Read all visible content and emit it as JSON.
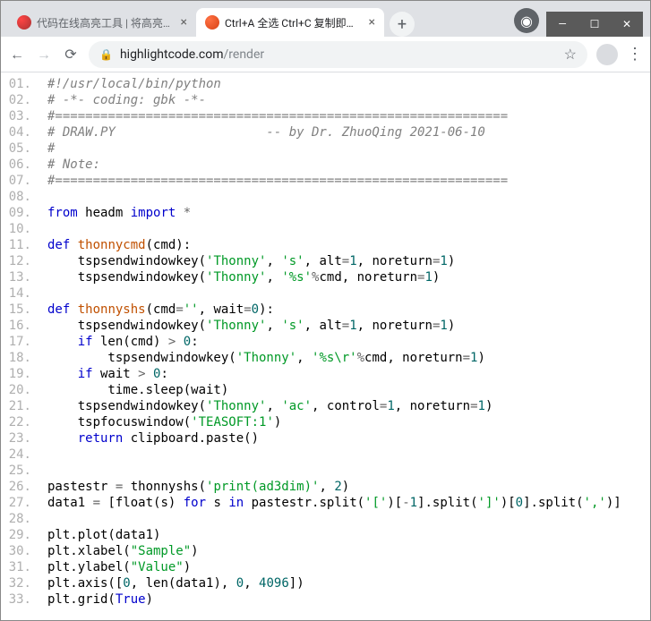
{
  "window": {
    "controls": {
      "min": "—",
      "max": "☐",
      "close": "✕"
    }
  },
  "tabs": {
    "items": [
      {
        "title": "代码在线高亮工具 | 将高亮美化的",
        "active": false
      },
      {
        "title": "Ctrl+A 全选 Ctrl+C 复制即可 - G",
        "active": true
      }
    ],
    "new_tab": "+",
    "account_icon": "◉"
  },
  "toolbar": {
    "back": "←",
    "forward": "→",
    "reload": "⟳",
    "lock": "🔒",
    "url_host": "highlightcode.com",
    "url_path": "/render",
    "star": "☆",
    "menu": "⋮"
  },
  "code": {
    "lines": [
      {
        "n": "01.",
        "segs": [
          [
            "c-comment",
            "#!/usr/local/bin/python"
          ]
        ]
      },
      {
        "n": "02.",
        "segs": [
          [
            "c-comment",
            "# -*- coding: gbk -*-"
          ]
        ]
      },
      {
        "n": "03.",
        "segs": [
          [
            "c-comment",
            "#============================================================"
          ]
        ]
      },
      {
        "n": "04.",
        "segs": [
          [
            "c-comment",
            "# DRAW.PY                    -- by Dr. ZhuoQing 2021-06-10"
          ]
        ]
      },
      {
        "n": "05.",
        "segs": [
          [
            "c-comment",
            "#"
          ]
        ]
      },
      {
        "n": "06.",
        "segs": [
          [
            "c-comment",
            "# Note:"
          ]
        ]
      },
      {
        "n": "07.",
        "segs": [
          [
            "c-comment",
            "#============================================================"
          ]
        ]
      },
      {
        "n": "08.",
        "segs": [
          [
            "c-plain",
            ""
          ]
        ]
      },
      {
        "n": "09.",
        "segs": [
          [
            "c-kw",
            "from"
          ],
          [
            "c-plain",
            " headm "
          ],
          [
            "c-kw",
            "import"
          ],
          [
            "c-plain",
            " "
          ],
          [
            "c-op",
            "*"
          ]
        ]
      },
      {
        "n": "10.",
        "segs": [
          [
            "c-plain",
            ""
          ]
        ]
      },
      {
        "n": "11.",
        "segs": [
          [
            "c-kw",
            "def"
          ],
          [
            "c-plain",
            " "
          ],
          [
            "c-def",
            "thonnycmd"
          ],
          [
            "c-plain",
            "(cmd):"
          ]
        ]
      },
      {
        "n": "12.",
        "segs": [
          [
            "c-plain",
            "    tspsendwindowkey("
          ],
          [
            "c-str",
            "'Thonny'"
          ],
          [
            "c-plain",
            ", "
          ],
          [
            "c-str",
            "'s'"
          ],
          [
            "c-plain",
            ", alt"
          ],
          [
            "c-op",
            "="
          ],
          [
            "c-num",
            "1"
          ],
          [
            "c-plain",
            ", noreturn"
          ],
          [
            "c-op",
            "="
          ],
          [
            "c-num",
            "1"
          ],
          [
            "c-plain",
            ")"
          ]
        ]
      },
      {
        "n": "13.",
        "segs": [
          [
            "c-plain",
            "    tspsendwindowkey("
          ],
          [
            "c-str",
            "'Thonny'"
          ],
          [
            "c-plain",
            ", "
          ],
          [
            "c-str",
            "'%s'"
          ],
          [
            "c-op",
            "%"
          ],
          [
            "c-plain",
            "cmd, noreturn"
          ],
          [
            "c-op",
            "="
          ],
          [
            "c-num",
            "1"
          ],
          [
            "c-plain",
            ")"
          ]
        ]
      },
      {
        "n": "14.",
        "segs": [
          [
            "c-plain",
            ""
          ]
        ]
      },
      {
        "n": "15.",
        "segs": [
          [
            "c-kw",
            "def"
          ],
          [
            "c-plain",
            " "
          ],
          [
            "c-def",
            "thonnyshs"
          ],
          [
            "c-plain",
            "(cmd"
          ],
          [
            "c-op",
            "="
          ],
          [
            "c-str",
            "''"
          ],
          [
            "c-plain",
            ", wait"
          ],
          [
            "c-op",
            "="
          ],
          [
            "c-num",
            "0"
          ],
          [
            "c-plain",
            "):"
          ]
        ]
      },
      {
        "n": "16.",
        "segs": [
          [
            "c-plain",
            "    tspsendwindowkey("
          ],
          [
            "c-str",
            "'Thonny'"
          ],
          [
            "c-plain",
            ", "
          ],
          [
            "c-str",
            "'s'"
          ],
          [
            "c-plain",
            ", alt"
          ],
          [
            "c-op",
            "="
          ],
          [
            "c-num",
            "1"
          ],
          [
            "c-plain",
            ", noreturn"
          ],
          [
            "c-op",
            "="
          ],
          [
            "c-num",
            "1"
          ],
          [
            "c-plain",
            ")"
          ]
        ]
      },
      {
        "n": "17.",
        "segs": [
          [
            "c-plain",
            "    "
          ],
          [
            "c-kw",
            "if"
          ],
          [
            "c-plain",
            " len(cmd) "
          ],
          [
            "c-op",
            ">"
          ],
          [
            "c-plain",
            " "
          ],
          [
            "c-num",
            "0"
          ],
          [
            "c-plain",
            ":"
          ]
        ]
      },
      {
        "n": "18.",
        "segs": [
          [
            "c-plain",
            "        tspsendwindowkey("
          ],
          [
            "c-str",
            "'Thonny'"
          ],
          [
            "c-plain",
            ", "
          ],
          [
            "c-str",
            "'%s\\r'"
          ],
          [
            "c-op",
            "%"
          ],
          [
            "c-plain",
            "cmd, noreturn"
          ],
          [
            "c-op",
            "="
          ],
          [
            "c-num",
            "1"
          ],
          [
            "c-plain",
            ")"
          ]
        ]
      },
      {
        "n": "19.",
        "segs": [
          [
            "c-plain",
            "    "
          ],
          [
            "c-kw",
            "if"
          ],
          [
            "c-plain",
            " wait "
          ],
          [
            "c-op",
            ">"
          ],
          [
            "c-plain",
            " "
          ],
          [
            "c-num",
            "0"
          ],
          [
            "c-plain",
            ":"
          ]
        ]
      },
      {
        "n": "20.",
        "segs": [
          [
            "c-plain",
            "        time.sleep(wait)"
          ]
        ]
      },
      {
        "n": "21.",
        "segs": [
          [
            "c-plain",
            "    tspsendwindowkey("
          ],
          [
            "c-str",
            "'Thonny'"
          ],
          [
            "c-plain",
            ", "
          ],
          [
            "c-str",
            "'ac'"
          ],
          [
            "c-plain",
            ", control"
          ],
          [
            "c-op",
            "="
          ],
          [
            "c-num",
            "1"
          ],
          [
            "c-plain",
            ", noreturn"
          ],
          [
            "c-op",
            "="
          ],
          [
            "c-num",
            "1"
          ],
          [
            "c-plain",
            ")"
          ]
        ]
      },
      {
        "n": "22.",
        "segs": [
          [
            "c-plain",
            "    tspfocuswindow("
          ],
          [
            "c-str",
            "'TEASOFT:1'"
          ],
          [
            "c-plain",
            ")"
          ]
        ]
      },
      {
        "n": "23.",
        "segs": [
          [
            "c-plain",
            "    "
          ],
          [
            "c-kw",
            "return"
          ],
          [
            "c-plain",
            " clipboard.paste()"
          ]
        ]
      },
      {
        "n": "24.",
        "segs": [
          [
            "c-plain",
            ""
          ]
        ]
      },
      {
        "n": "25.",
        "segs": [
          [
            "c-plain",
            ""
          ]
        ]
      },
      {
        "n": "26.",
        "segs": [
          [
            "c-plain",
            "pastestr "
          ],
          [
            "c-op",
            "="
          ],
          [
            "c-plain",
            " thonnyshs("
          ],
          [
            "c-str",
            "'print(ad3dim)'"
          ],
          [
            "c-plain",
            ", "
          ],
          [
            "c-num",
            "2"
          ],
          [
            "c-plain",
            ")"
          ]
        ]
      },
      {
        "n": "27.",
        "segs": [
          [
            "c-plain",
            "data1 "
          ],
          [
            "c-op",
            "="
          ],
          [
            "c-plain",
            " [float(s) "
          ],
          [
            "c-kw",
            "for"
          ],
          [
            "c-plain",
            " s "
          ],
          [
            "c-kw",
            "in"
          ],
          [
            "c-plain",
            " pastestr.split("
          ],
          [
            "c-str",
            "'['"
          ],
          [
            "c-plain",
            ")["
          ],
          [
            "c-op",
            "-"
          ],
          [
            "c-num",
            "1"
          ],
          [
            "c-plain",
            "].split("
          ],
          [
            "c-str",
            "']'"
          ],
          [
            "c-plain",
            ")["
          ],
          [
            "c-num",
            "0"
          ],
          [
            "c-plain",
            "].split("
          ],
          [
            "c-str",
            "','"
          ],
          [
            "c-plain",
            ")]"
          ]
        ]
      },
      {
        "n": "28.",
        "segs": [
          [
            "c-plain",
            ""
          ]
        ]
      },
      {
        "n": "29.",
        "segs": [
          [
            "c-plain",
            "plt.plot(data1)"
          ]
        ]
      },
      {
        "n": "30.",
        "segs": [
          [
            "c-plain",
            "plt.xlabel("
          ],
          [
            "c-str",
            "\"Sample\""
          ],
          [
            "c-plain",
            ")"
          ]
        ]
      },
      {
        "n": "31.",
        "segs": [
          [
            "c-plain",
            "plt.ylabel("
          ],
          [
            "c-str",
            "\"Value\""
          ],
          [
            "c-plain",
            ")"
          ]
        ]
      },
      {
        "n": "32.",
        "segs": [
          [
            "c-plain",
            "plt.axis(["
          ],
          [
            "c-num",
            "0"
          ],
          [
            "c-plain",
            ", len(data1), "
          ],
          [
            "c-num",
            "0"
          ],
          [
            "c-plain",
            ", "
          ],
          [
            "c-num",
            "4096"
          ],
          [
            "c-plain",
            "])"
          ]
        ]
      },
      {
        "n": "33.",
        "segs": [
          [
            "c-plain",
            "plt.grid("
          ],
          [
            "c-kw",
            "True"
          ],
          [
            "c-plain",
            ")"
          ]
        ]
      }
    ]
  }
}
